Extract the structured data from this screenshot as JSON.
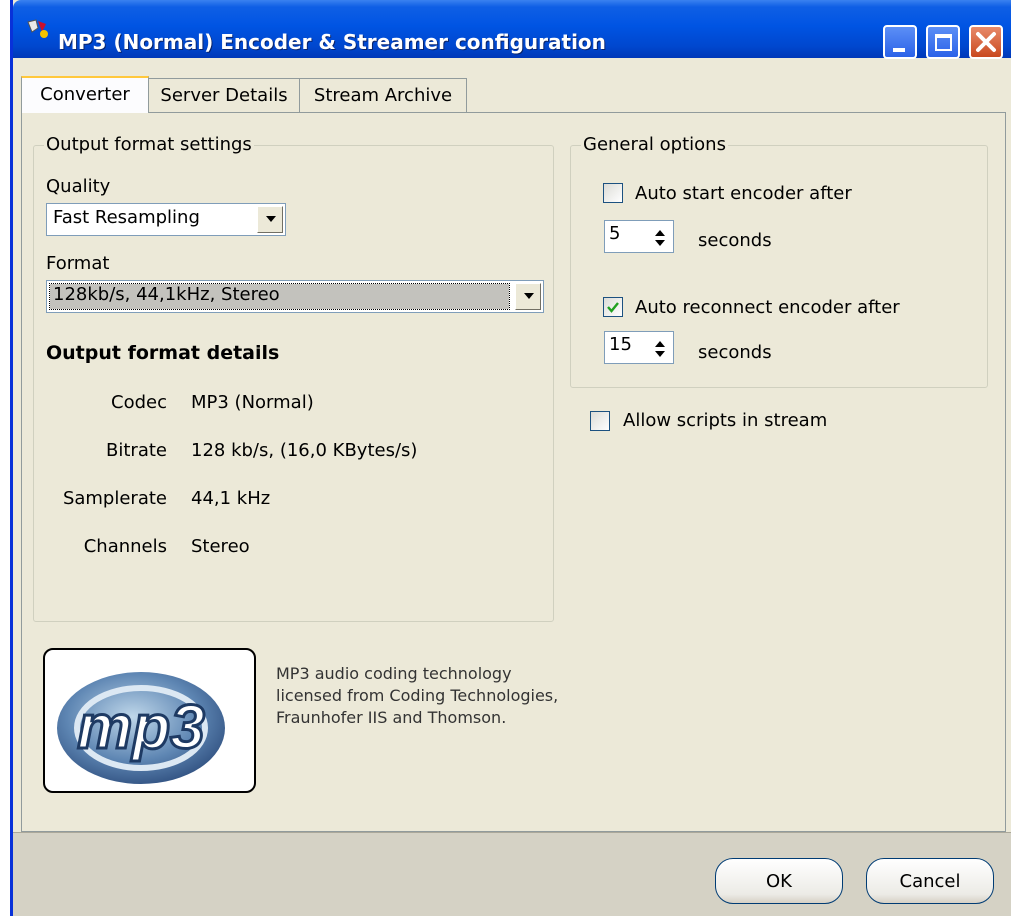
{
  "window": {
    "title": "MP3 (Normal) Encoder & Streamer configuration",
    "controls": [
      "minimize-icon",
      "maximize-icon",
      "close-icon"
    ]
  },
  "tabs": [
    {
      "label": "Converter",
      "active": true
    },
    {
      "label": "Server Details",
      "active": false
    },
    {
      "label": "Stream Archive",
      "active": false
    }
  ],
  "output_format": {
    "legend": "Output format settings",
    "quality_label": "Quality",
    "quality_value": "Fast Resampling",
    "format_label": "Format",
    "format_value": "128kb/s, 44,1kHz, Stereo",
    "details_heading": "Output format details",
    "details": [
      {
        "key": "Codec",
        "value": "MP3 (Normal)"
      },
      {
        "key": "Bitrate",
        "value": "128 kb/s, (16,0 KBytes/s)"
      },
      {
        "key": "Samplerate",
        "value": "44,1 kHz"
      },
      {
        "key": "Channels",
        "value": "Stereo"
      }
    ]
  },
  "general_options": {
    "legend": "General options",
    "auto_start_label": "Auto start encoder after",
    "auto_start_checked": false,
    "auto_start_seconds": "5",
    "auto_reconnect_label": "Auto reconnect encoder after",
    "auto_reconnect_checked": true,
    "auto_reconnect_seconds": "15",
    "seconds_label": "seconds"
  },
  "allow_scripts": {
    "label": "Allow scripts in stream",
    "checked": false
  },
  "license": {
    "logo_text": "mp3",
    "text": "MP3 audio coding technology licensed from Coding Technologies, Fraunhofer IIS and Thomson."
  },
  "buttons": {
    "ok": "OK",
    "cancel": "Cancel"
  },
  "colors": {
    "titlebar": "#0054E3",
    "dialog_bg": "#ECE9D8",
    "tab_highlight": "#FFC83C",
    "close_button": "#C9491E"
  }
}
